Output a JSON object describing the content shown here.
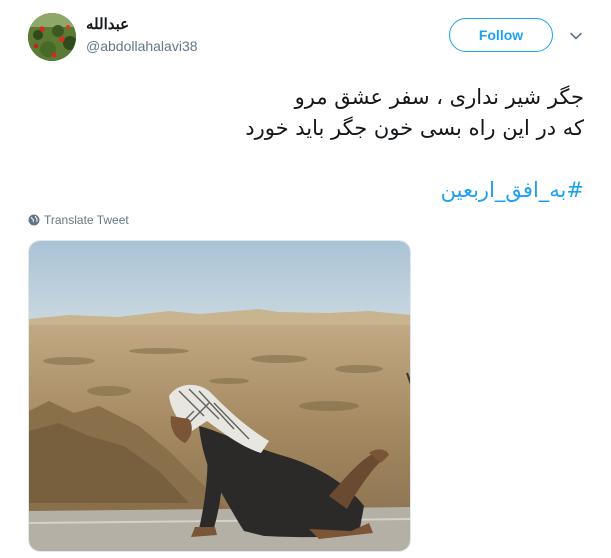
{
  "tweet": {
    "user": {
      "display_name": "عبدالله",
      "screen_name": "@abdollahalavi38",
      "avatar_icon": "avatar-poppies-field"
    },
    "follow_label": "Follow",
    "text_lines": [
      "جگر شیر نداری ، سفر عشق مرو",
      "که در این راه بسی خون جگر باید خورد"
    ],
    "hashtag": "#به_افق_اربعین",
    "translate_label": "Translate Tweet",
    "media_description_icon": "photo-pilgrim-crawling-desert-road"
  },
  "colors": {
    "accent": "#1da1f2",
    "text_primary": "#14171a",
    "text_secondary": "#657786"
  }
}
